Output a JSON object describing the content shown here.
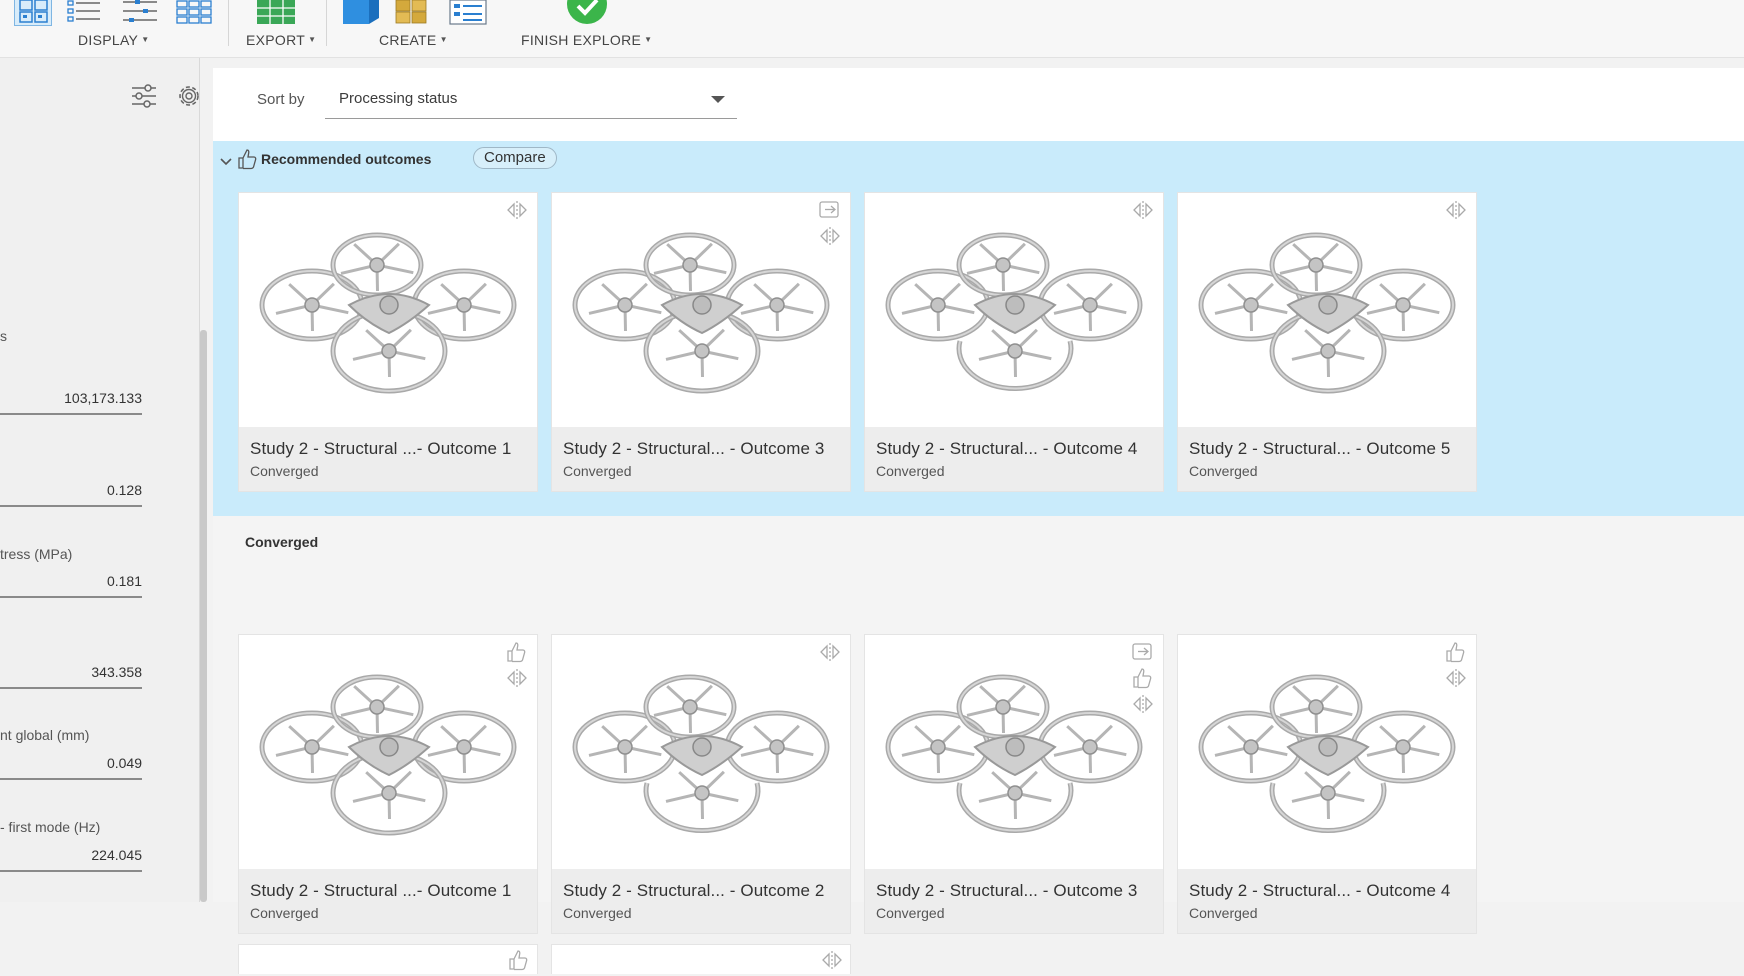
{
  "toolbar": {
    "display_label": "DISPLAY",
    "export_label": "EXPORT",
    "create_label": "CREATE",
    "finish_label": "FINISH EXPLORE"
  },
  "left_panel": {
    "partial_heading": "s",
    "metrics": [
      {
        "label": "",
        "value": "103,173.133"
      },
      {
        "label": "",
        "value": "0.128"
      },
      {
        "label": "tress (MPa)",
        "value": "0.181"
      },
      {
        "label": "",
        "value": "343.358"
      },
      {
        "label": "nt global (mm)",
        "value": "0.049"
      },
      {
        "label": "- first mode (Hz)",
        "value": "224.045"
      }
    ]
  },
  "sort": {
    "label": "Sort by",
    "value": "Processing status"
  },
  "recommended": {
    "title": "Recommended outcomes",
    "compare_label": "Compare",
    "cards": [
      {
        "title": "Study 2 - Structural ...- Outcome 1",
        "status": "Converged"
      },
      {
        "title": "Study 2 - Structural... - Outcome 3",
        "status": "Converged"
      },
      {
        "title": "Study 2 - Structural... - Outcome 4",
        "status": "Converged"
      },
      {
        "title": "Study 2 - Structural... - Outcome 5",
        "status": "Converged"
      }
    ]
  },
  "converged": {
    "title": "Converged",
    "cards": [
      {
        "title": "Study 2 - Structural ...- Outcome 1",
        "status": "Converged"
      },
      {
        "title": "Study 2 - Structural... - Outcome 2",
        "status": "Converged"
      },
      {
        "title": "Study 2 - Structural... - Outcome 3",
        "status": "Converged"
      },
      {
        "title": "Study 2 - Structural... - Outcome 4",
        "status": "Converged"
      }
    ]
  },
  "colors": {
    "recommended_bg": "#c9ebfb",
    "accent_blue": "#2a8fdc",
    "finish_green": "#3bb54a"
  }
}
